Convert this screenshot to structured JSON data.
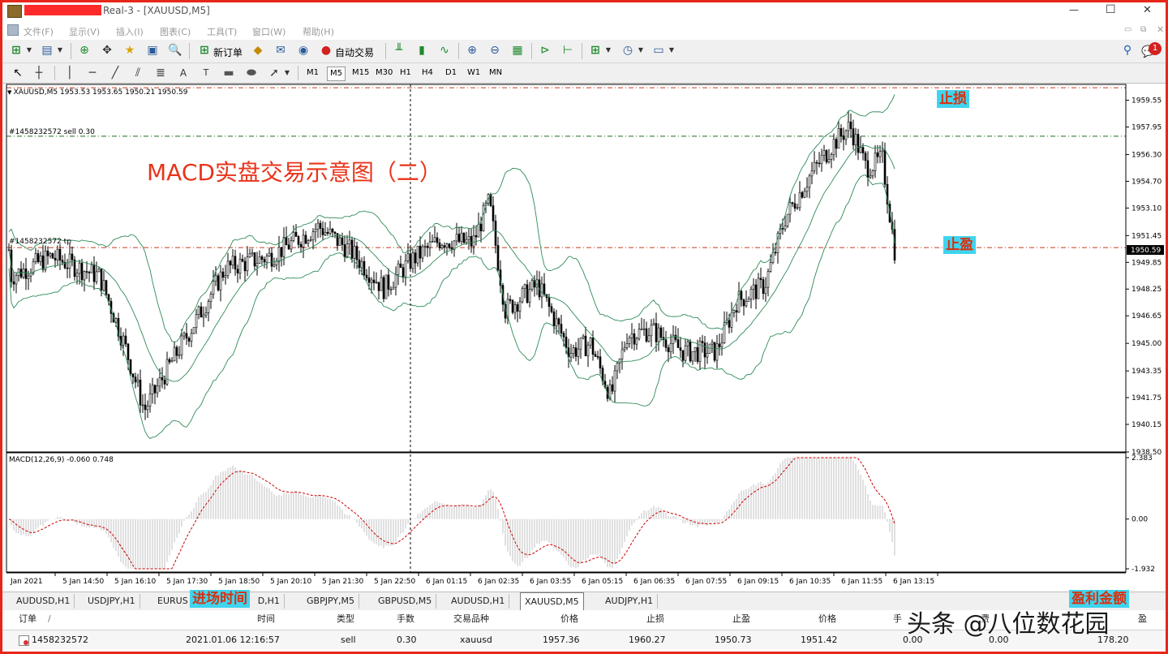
{
  "window": {
    "title": "Real-3 - [XAUUSD,M5]",
    "minimize_glyph": "—",
    "maximize_glyph": "☐",
    "close_glyph": "✕"
  },
  "menu": [
    "文件(F)",
    "显示(V)",
    "插入(I)",
    "图表(C)",
    "工具(T)",
    "窗口(W)",
    "帮助(H)"
  ],
  "toolbar": {
    "new_order": "新订单",
    "auto_trade": "自动交易",
    "notifications_count": "1"
  },
  "timeframes": [
    "M1",
    "M5",
    "M15",
    "M30",
    "H1",
    "H4",
    "D1",
    "W1",
    "MN"
  ],
  "active_timeframe": "M5",
  "chart": {
    "symbol_info": "XAUUSD,M5  1953.53 1953.65 1950.21 1950.59",
    "annotation_title": "MACD实盘交易示意图（二）",
    "sl_line_label": "#1458232572 sell 0.30",
    "tp_line_label": "#1458232572 tp",
    "current_price": "1950.59",
    "price_ticks": [
      "1959.55",
      "1957.95",
      "1956.30",
      "1954.70",
      "1953.10",
      "1951.45",
      "1949.85",
      "1948.25",
      "1946.65",
      "1945.00",
      "1943.35",
      "1941.75",
      "1940.15",
      "1938.50"
    ],
    "macd_label": "MACD(12,26,9) -0.060 0.748",
    "macd_ticks": [
      "2.383",
      "0.00",
      "-1.932"
    ],
    "time_ticks": [
      "Jan 2021",
      "5 Jan 14:50",
      "5 Jan 16:10",
      "5 Jan 17:30",
      "5 Jan 18:50",
      "5 Jan 20:10",
      "5 Jan 21:30",
      "5 Jan 22:50",
      "6 Jan 01:15",
      "6 Jan 02:35",
      "6 Jan 03:55",
      "6 Jan 05:15",
      "6 Jan 06:35",
      "6 Jan 07:55",
      "6 Jan 09:15",
      "6 Jan 10:35",
      "6 Jan 11:55",
      "6 Jan 13:15"
    ],
    "colors": {
      "sl_line": "#1f6b1f",
      "tp_line": "#c23b22",
      "bands": "#2e8b57",
      "macd_signal": "#cc0000",
      "macd_hist": "#c0c0c0",
      "callout_bg": "#3fd4ef",
      "callout_text": "#d8300f",
      "annotation": "#e8341a"
    }
  },
  "callouts": {
    "stop_loss": "止损",
    "take_profit": "止盈",
    "entry_time": "进场时间",
    "profit_amount": "盈利金额"
  },
  "chart_tabs": [
    "AUDUSD,H1",
    "USDJPY,H1",
    "EURUS",
    "D,H1",
    "GBPJPY,M5",
    "GBPUSD,M5",
    "AUDUSD,H1",
    "XAUUSD,M5",
    "AUDJPY,H1"
  ],
  "active_chart_tab": "XAUUSD,M5",
  "terminal": {
    "headers": [
      "订单",
      "/",
      "时间",
      "类型",
      "手数",
      "交易品种",
      "价格",
      "止损",
      "止盈",
      "价格",
      "手",
      "费",
      "盈"
    ],
    "row": {
      "order": "1458232572",
      "time": "2021.01.06 12:16:57",
      "type": "sell",
      "lots": "0.30",
      "symbol": "xauusd",
      "price": "1957.36",
      "sl": "1960.27",
      "tp": "1950.73",
      "current_price": "1951.42",
      "commission": "0.00",
      "swap": "0.00",
      "profit": "178.20"
    }
  },
  "watermark": "头条 @八位数花园"
}
